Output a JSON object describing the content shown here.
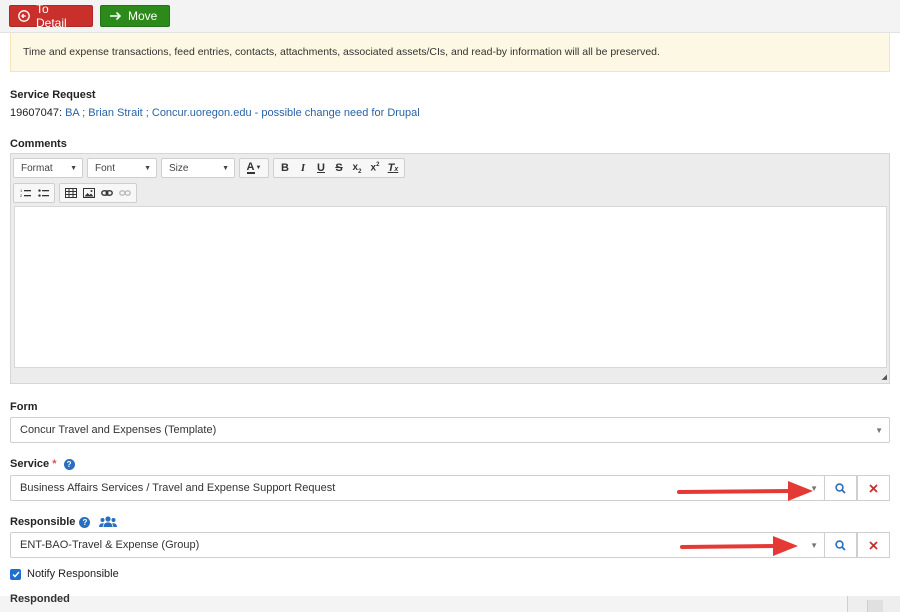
{
  "toolbar": {
    "to_detail_label": "To Detail",
    "move_label": "Move"
  },
  "banner": {
    "text": "Time and expense transactions, feed entries, contacts, attachments, associated assets/CIs, and read-by information will all be preserved."
  },
  "service_request": {
    "label": "Service Request",
    "id_prefix": "19607047:",
    "link_text": "BA ; Brian Strait ; Concur.uoregon.edu - possible change need for Drupal"
  },
  "comments": {
    "label": "Comments",
    "format_label": "Format",
    "font_label": "Font",
    "size_label": "Size"
  },
  "form": {
    "label": "Form",
    "value": "Concur Travel and Expenses (Template)"
  },
  "service": {
    "label": "Service",
    "required_mark": "*",
    "help": "?",
    "value": "Business Affairs Services / Travel and Expense Support Request"
  },
  "responsible": {
    "label": "Responsible",
    "help": "?",
    "value": "ENT-BAO-Travel & Expense (Group)"
  },
  "notify": {
    "label": "Notify Responsible",
    "checked": true
  },
  "responded_label": "Responded",
  "colors": {
    "danger": "#c9302c",
    "success": "#2b8a19",
    "link": "#2a63a6",
    "annotation_arrow": "#e53935",
    "banner_bg": "#fcf8e3"
  },
  "icons": {
    "to_detail": "circle-arrow-left-icon",
    "move": "arrow-right-icon",
    "search": "search-icon",
    "clear": "close-icon",
    "group": "users-icon",
    "help": "question-circle-icon"
  }
}
